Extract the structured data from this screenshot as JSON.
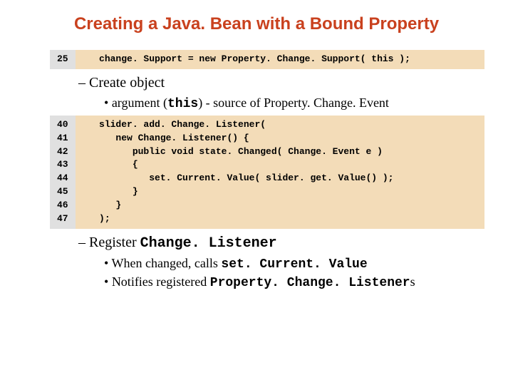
{
  "title": "Creating a Java. Bean with a Bound Property",
  "codeblock1": {
    "gutter": "25",
    "code": "   change. Support = new Property. Change. Support( this );"
  },
  "section1": {
    "dash": "Create object",
    "dot_pre": "argument (",
    "dot_mono": "this",
    "dot_post": ") - source of Property. Change. Event"
  },
  "codeblock2": {
    "gutter": "40\n41\n42\n43\n44\n45\n46\n47",
    "code": "   slider. add. Change. Listener(\n      new Change. Listener() {\n         public void state. Changed( Change. Event e )\n         {\n            set. Current. Value( slider. get. Value() );\n         }\n      }\n   );"
  },
  "section2": {
    "dash_pre": "Register ",
    "dash_mono": "Change. Listener",
    "dot1_pre": "When changed, calls ",
    "dot1_mono": "set. Current. Value",
    "dot2_pre": "Notifies registered ",
    "dot2_mono": "Property. Change. Listener",
    "dot2_post": "s"
  }
}
